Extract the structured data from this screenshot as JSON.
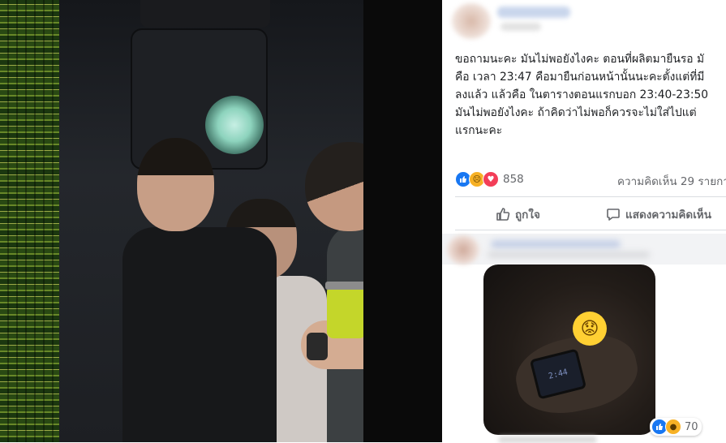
{
  "post": {
    "text": "ขอถามนะคะ มันไม่พอยังไงคะ ตอนที่ผลิตมายืนรอ มั\nคือ เวลา 23:47 คือมายืนก่อนหน้านั้นนะคะตั้งแต่ที่มี\nลงแล้ว แล้วคือ ในตารางตอนแรกบอก 23:40-23:50\nมันไม่พอยังไงคะ ถ้าคิดว่าไม่พอก็ควรจะไม่ใส่ไปแต่\nแรกนะคะ",
    "reaction_count": "858",
    "comments_count": "ความคิดเห็น 29 รายกา",
    "like_label": "ถูกใจ",
    "comment_label": "แสดงความคิดเห็น"
  },
  "comment": {
    "photo_reaction_count": "70",
    "emoji": "😟",
    "watch_text": "2:44"
  },
  "reaction_icons": [
    "like-icon",
    "sad-icon",
    "love-icon"
  ],
  "colors": {
    "like": "#1877f2",
    "love": "#f33e58",
    "sad": "#f7b125",
    "text": "#1c1e21",
    "muted": "#65676b"
  }
}
